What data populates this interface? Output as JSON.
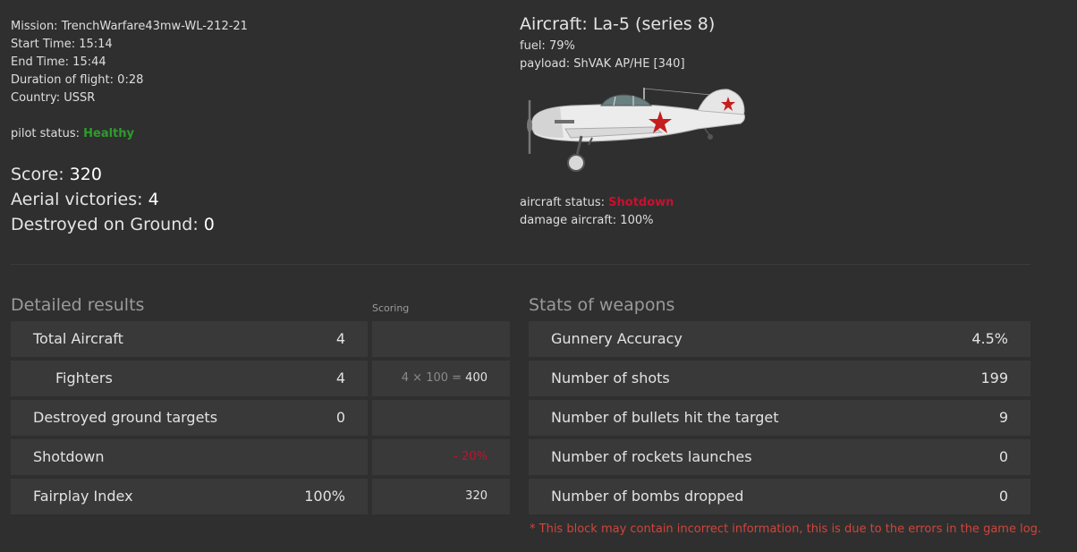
{
  "mission": {
    "mission_label": "Mission: ",
    "mission_name": "TrenchWarfare43mw-WL-212-21",
    "start_label": "Start Time: ",
    "start_time": "15:14",
    "end_label": "End Time: ",
    "end_time": "15:44",
    "duration_label": "Duration of flight: ",
    "duration": "0:28",
    "country_label": "Country: ",
    "country": "USSR",
    "pilot_status_label": "pilot status: ",
    "pilot_status": "Healthy"
  },
  "summary": {
    "score_label": "Score: ",
    "score": "320",
    "aerial_label": "Aerial victories: ",
    "aerial": "4",
    "ground_label": "Destroyed on Ground: ",
    "ground": "0"
  },
  "aircraft": {
    "title": "Aircraft: La-5 (series 8)",
    "fuel_label": "fuel: ",
    "fuel": "79%",
    "payload_label": "payload: ",
    "payload": "ShVAK AP/HE [340]",
    "status_label": "aircraft status: ",
    "status": "Shotdown",
    "damage_label": "damage aircraft: ",
    "damage": "100%",
    "image_icon": "la5-fighter-plane-image"
  },
  "detailed": {
    "title": "Detailed results",
    "scoring_title": "Scoring",
    "rows": [
      {
        "label": "Total Aircraft",
        "value": "4",
        "formula": "",
        "score": ""
      },
      {
        "label": "Fighters",
        "value": "4",
        "formula": "4 × 100 = ",
        "score": "400"
      },
      {
        "label": "Destroyed ground targets",
        "value": "0",
        "formula": "",
        "score": ""
      },
      {
        "label": "Shotdown",
        "value": "",
        "formula": "",
        "score": "- 20%"
      },
      {
        "label": "Fairplay Index",
        "value": "100%",
        "formula": "",
        "score": "320"
      }
    ]
  },
  "weapons": {
    "title": "Stats of weapons",
    "rows": [
      {
        "label": "Gunnery Accuracy",
        "value": "4.5%"
      },
      {
        "label": "Number of shots",
        "value": "199"
      },
      {
        "label": "Number of bullets hit the target",
        "value": "9"
      },
      {
        "label": "Number of rockets launches",
        "value": "0"
      },
      {
        "label": "Number of bombs dropped",
        "value": "0"
      }
    ],
    "note": "* This block may contain incorrect information, this is due to the errors in the game log."
  },
  "colors": {
    "background": "#2f2f2f",
    "cell": "#393939",
    "healthy": "#2c9c2c",
    "shotdown": "#c8102e",
    "note": "#d0453c"
  }
}
